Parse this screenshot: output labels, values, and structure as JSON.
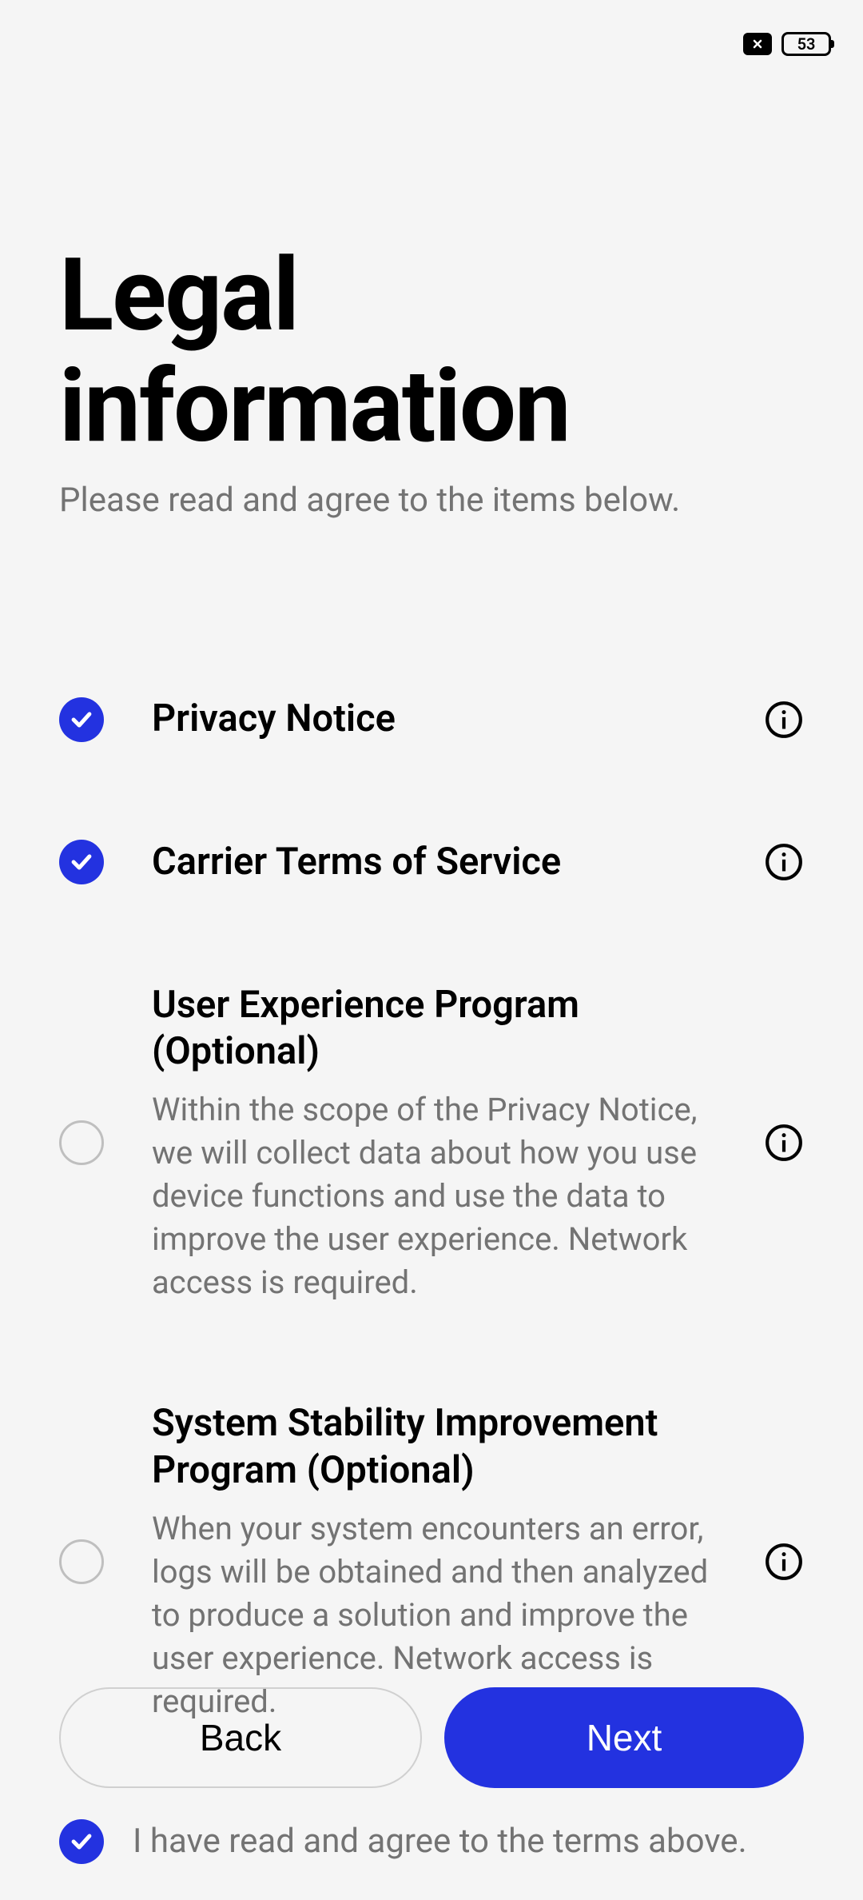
{
  "status_bar": {
    "battery": "53"
  },
  "header": {
    "title_line1": "Legal",
    "title_line2": "information",
    "subtitle": "Please read and agree to the items below."
  },
  "items": [
    {
      "title": "Privacy Notice",
      "desc": "",
      "checked": true
    },
    {
      "title": "Carrier Terms of Service",
      "desc": "",
      "checked": true
    },
    {
      "title": "User Experience Program (Optional)",
      "desc": "Within the scope of the Privacy Notice, we will collect data about how you use device functions and use the data to improve the user experience. Network access is required.",
      "checked": false
    },
    {
      "title": "System Stability Improvement Program (Optional)",
      "desc": "When your system encounters an error, logs will be obtained and then analyzed to produce a solution and improve the user experience. Network access is required.",
      "checked": false
    }
  ],
  "agree": {
    "checked": true,
    "label": "I have read and agree to the terms above."
  },
  "buttons": {
    "back": "Back",
    "next": "Next"
  },
  "colors": {
    "accent": "#2332e0",
    "muted": "#737373"
  }
}
